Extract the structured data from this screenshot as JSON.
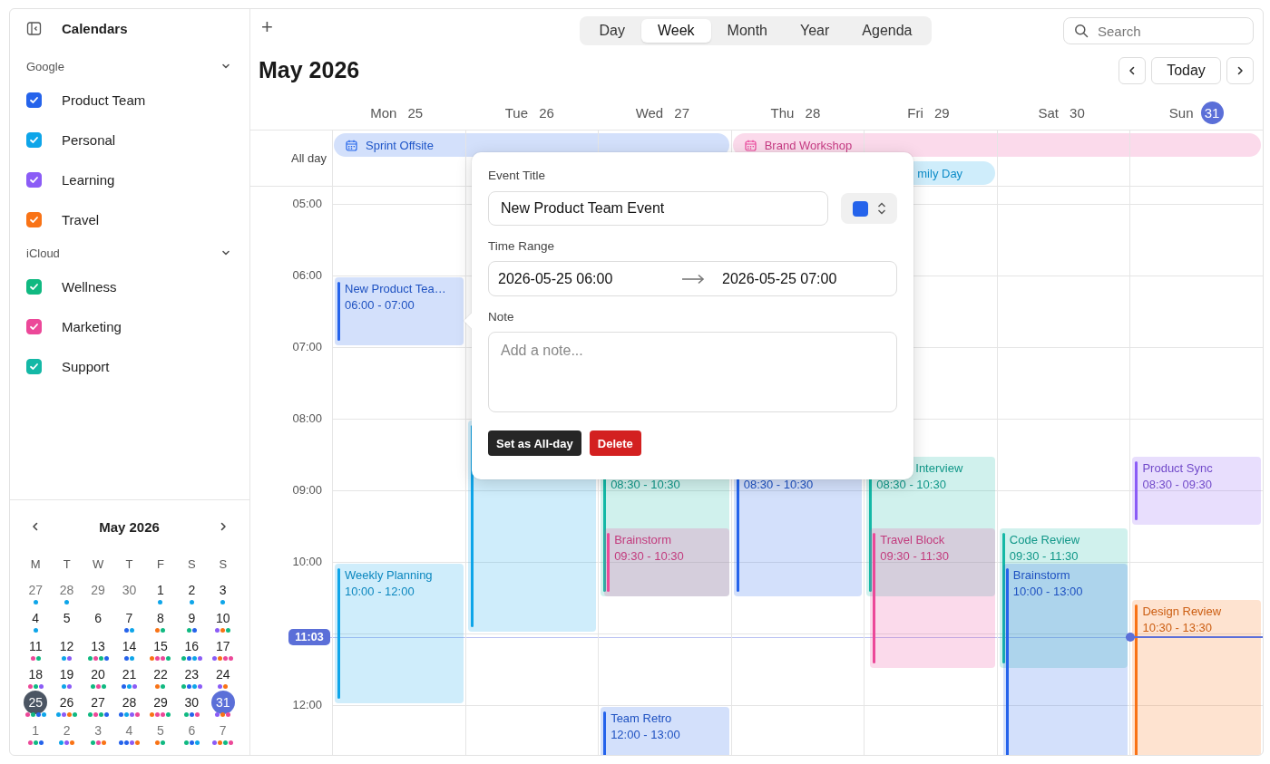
{
  "sidebar": {
    "title": "Calendars",
    "groups": [
      {
        "name": "Google",
        "expanded": true,
        "calendars": [
          {
            "name": "Product Team",
            "checked": true,
            "color": "#2563eb"
          },
          {
            "name": "Personal",
            "checked": true,
            "color": "#0ea5e9"
          },
          {
            "name": "Learning",
            "checked": true,
            "color": "#8b5cf6"
          },
          {
            "name": "Travel",
            "checked": true,
            "color": "#f97316"
          }
        ]
      },
      {
        "name": "iCloud",
        "expanded": true,
        "calendars": [
          {
            "name": "Wellness",
            "checked": true,
            "color": "#10b981"
          },
          {
            "name": "Marketing",
            "checked": true,
            "color": "#ec4899"
          },
          {
            "name": "Support",
            "checked": true,
            "color": "#14b8a6"
          }
        ]
      }
    ]
  },
  "mini_calendar": {
    "title": "May 2026",
    "weekdays": [
      "M",
      "T",
      "W",
      "T",
      "F",
      "S",
      "S"
    ],
    "weeks": [
      {
        "days": [
          {
            "date": "27",
            "outside": true,
            "selected": false,
            "today": false,
            "dots": [
              {
                "color": "#0ea5e9"
              }
            ]
          },
          {
            "date": "28",
            "outside": true,
            "selected": false,
            "today": false,
            "dots": [
              {
                "color": "#0ea5e9"
              }
            ]
          },
          {
            "date": "29",
            "outside": true,
            "selected": false,
            "today": false
          },
          {
            "date": "30",
            "outside": true,
            "selected": false,
            "today": false
          },
          {
            "date": "1",
            "outside": false,
            "selected": false,
            "today": false,
            "dots": [
              {
                "color": "#0ea5e9"
              }
            ]
          },
          {
            "date": "2",
            "outside": false,
            "selected": false,
            "today": false,
            "dots": [
              {
                "color": "#0ea5e9"
              }
            ]
          },
          {
            "date": "3",
            "outside": false,
            "selected": false,
            "today": false,
            "dots": [
              {
                "color": "#0ea5e9"
              }
            ]
          }
        ]
      },
      {
        "days": [
          {
            "date": "4",
            "outside": false,
            "selected": false,
            "today": false,
            "dots": [
              {
                "color": "#0ea5e9"
              }
            ]
          },
          {
            "date": "5",
            "outside": false,
            "selected": false,
            "today": false
          },
          {
            "date": "6",
            "outside": false,
            "selected": false,
            "today": false
          },
          {
            "date": "7",
            "outside": false,
            "selected": false,
            "today": false,
            "dots": [
              {
                "color": "#2563eb"
              },
              {
                "color": "#0ea5e9"
              }
            ]
          },
          {
            "date": "8",
            "outside": false,
            "selected": false,
            "today": false,
            "dots": [
              {
                "color": "#f97316"
              },
              {
                "color": "#10b981"
              }
            ]
          },
          {
            "date": "9",
            "outside": false,
            "selected": false,
            "today": false,
            "dots": [
              {
                "color": "#10b981"
              },
              {
                "color": "#2563eb"
              }
            ]
          },
          {
            "date": "10",
            "outside": false,
            "selected": false,
            "today": false,
            "dots": [
              {
                "color": "#8b5cf6"
              },
              {
                "color": "#f97316"
              },
              {
                "color": "#10b981"
              }
            ]
          }
        ]
      },
      {
        "days": [
          {
            "date": "11",
            "outside": false,
            "selected": false,
            "today": false,
            "dots": [
              {
                "color": "#ec4899"
              },
              {
                "color": "#10b981"
              }
            ]
          },
          {
            "date": "12",
            "outside": false,
            "selected": false,
            "today": false,
            "dots": [
              {
                "color": "#0ea5e9"
              },
              {
                "color": "#8b5cf6"
              }
            ]
          },
          {
            "date": "13",
            "outside": false,
            "selected": false,
            "today": false,
            "dots": [
              {
                "color": "#10b981"
              },
              {
                "color": "#ec4899"
              },
              {
                "color": "#10b981"
              },
              {
                "color": "#2563eb"
              }
            ]
          },
          {
            "date": "14",
            "outside": false,
            "selected": false,
            "today": false,
            "dots": [
              {
                "color": "#2563eb"
              },
              {
                "color": "#0ea5e9"
              }
            ]
          },
          {
            "date": "15",
            "outside": false,
            "selected": false,
            "today": false,
            "dots": [
              {
                "color": "#f97316"
              },
              {
                "color": "#ec4899"
              },
              {
                "color": "#ec4899"
              },
              {
                "color": "#10b981"
              }
            ]
          },
          {
            "date": "16",
            "outside": false,
            "selected": false,
            "today": false,
            "dots": [
              {
                "color": "#10b981"
              },
              {
                "color": "#2563eb"
              },
              {
                "color": "#0ea5e9"
              },
              {
                "color": "#8b5cf6"
              }
            ]
          },
          {
            "date": "17",
            "outside": false,
            "selected": false,
            "today": false,
            "dots": [
              {
                "color": "#8b5cf6"
              },
              {
                "color": "#f97316"
              },
              {
                "color": "#ec4899"
              },
              {
                "color": "#ec4899"
              }
            ]
          }
        ]
      },
      {
        "days": [
          {
            "date": "18",
            "outside": false,
            "selected": false,
            "today": false,
            "dots": [
              {
                "color": "#ec4899"
              },
              {
                "color": "#10b981"
              },
              {
                "color": "#8b5cf6"
              }
            ]
          },
          {
            "date": "19",
            "outside": false,
            "selected": false,
            "today": false,
            "dots": [
              {
                "color": "#0ea5e9"
              },
              {
                "color": "#8b5cf6"
              }
            ]
          },
          {
            "date": "20",
            "outside": false,
            "selected": false,
            "today": false,
            "dots": [
              {
                "color": "#10b981"
              },
              {
                "color": "#ec4899"
              },
              {
                "color": "#10b981"
              }
            ]
          },
          {
            "date": "21",
            "outside": false,
            "selected": false,
            "today": false,
            "dots": [
              {
                "color": "#2563eb"
              },
              {
                "color": "#0ea5e9"
              },
              {
                "color": "#8b5cf6"
              }
            ]
          },
          {
            "date": "22",
            "outside": false,
            "selected": false,
            "today": false,
            "dots": [
              {
                "color": "#f97316"
              },
              {
                "color": "#10b981"
              }
            ]
          },
          {
            "date": "23",
            "outside": false,
            "selected": false,
            "today": false,
            "dots": [
              {
                "color": "#10b981"
              },
              {
                "color": "#2563eb"
              },
              {
                "color": "#0ea5e9"
              },
              {
                "color": "#8b5cf6"
              }
            ]
          },
          {
            "date": "24",
            "outside": false,
            "selected": false,
            "today": false,
            "dots": [
              {
                "color": "#8b5cf6"
              },
              {
                "color": "#f97316"
              }
            ]
          }
        ]
      },
      {
        "days": [
          {
            "date": "25",
            "outside": false,
            "selected": true,
            "today": false,
            "dots": [
              {
                "color": "#ec4899"
              },
              {
                "color": "#10b981"
              },
              {
                "color": "#2563eb"
              },
              {
                "color": "#0ea5e9"
              }
            ]
          },
          {
            "date": "26",
            "outside": false,
            "selected": false,
            "today": false,
            "dots": [
              {
                "color": "#0ea5e9"
              },
              {
                "color": "#8b5cf6"
              },
              {
                "color": "#f97316"
              },
              {
                "color": "#10b981"
              }
            ]
          },
          {
            "date": "27",
            "outside": false,
            "selected": false,
            "today": false,
            "dots": [
              {
                "color": "#10b981"
              },
              {
                "color": "#ec4899"
              },
              {
                "color": "#10b981"
              },
              {
                "color": "#2563eb"
              }
            ]
          },
          {
            "date": "28",
            "outside": false,
            "selected": false,
            "today": false,
            "dots": [
              {
                "color": "#2563eb"
              },
              {
                "color": "#0ea5e9"
              },
              {
                "color": "#8b5cf6"
              },
              {
                "color": "#ec4899"
              }
            ]
          },
          {
            "date": "29",
            "outside": false,
            "selected": false,
            "today": false,
            "dots": [
              {
                "color": "#f97316"
              },
              {
                "color": "#ec4899"
              },
              {
                "color": "#ec4899"
              },
              {
                "color": "#10b981"
              }
            ]
          },
          {
            "date": "30",
            "outside": false,
            "selected": false,
            "today": false,
            "dots": [
              {
                "color": "#10b981"
              },
              {
                "color": "#2563eb"
              },
              {
                "color": "#ec4899"
              }
            ]
          },
          {
            "date": "31",
            "outside": false,
            "selected": false,
            "today": true,
            "dots": [
              {
                "color": "#8b5cf6"
              },
              {
                "color": "#f97316"
              },
              {
                "color": "#ec4899"
              }
            ]
          }
        ]
      },
      {
        "days": [
          {
            "date": "1",
            "outside": true,
            "selected": false,
            "today": false,
            "dots": [
              {
                "color": "#ec4899"
              },
              {
                "color": "#10b981"
              },
              {
                "color": "#2563eb"
              }
            ]
          },
          {
            "date": "2",
            "outside": true,
            "selected": false,
            "today": false,
            "dots": [
              {
                "color": "#0ea5e9"
              },
              {
                "color": "#8b5cf6"
              },
              {
                "color": "#f97316"
              }
            ]
          },
          {
            "date": "3",
            "outside": true,
            "selected": false,
            "today": false,
            "dots": [
              {
                "color": "#10b981"
              },
              {
                "color": "#ec4899"
              },
              {
                "color": "#f97316"
              }
            ]
          },
          {
            "date": "4",
            "outside": true,
            "selected": false,
            "today": false,
            "dots": [
              {
                "color": "#2563eb"
              },
              {
                "color": "#2563eb"
              },
              {
                "color": "#8b5cf6"
              },
              {
                "color": "#f97316"
              }
            ]
          },
          {
            "date": "5",
            "outside": true,
            "selected": false,
            "today": false,
            "dots": [
              {
                "color": "#f97316"
              },
              {
                "color": "#10b981"
              }
            ]
          },
          {
            "date": "6",
            "outside": true,
            "selected": false,
            "today": false,
            "dots": [
              {
                "color": "#10b981"
              },
              {
                "color": "#2563eb"
              },
              {
                "color": "#0ea5e9"
              }
            ]
          },
          {
            "date": "7",
            "outside": true,
            "selected": false,
            "today": false,
            "dots": [
              {
                "color": "#8b5cf6"
              },
              {
                "color": "#f97316"
              },
              {
                "color": "#10b981"
              },
              {
                "color": "#ec4899"
              }
            ]
          }
        ]
      }
    ]
  },
  "toolbar": {
    "add": "+",
    "views": [
      {
        "label": "Day",
        "selected": false
      },
      {
        "label": "Week",
        "selected": true
      },
      {
        "label": "Month",
        "selected": false
      },
      {
        "label": "Year",
        "selected": false
      },
      {
        "label": "Agenda",
        "selected": false
      }
    ],
    "search": {
      "placeholder": "Search"
    }
  },
  "header": {
    "title": "May 2026",
    "today": "Today"
  },
  "week": {
    "all_day_label": "All day",
    "hours": [
      "05:00",
      "06:00",
      "07:00",
      "08:00",
      "09:00",
      "10:00",
      "12:00"
    ],
    "now": "11:03",
    "days": [
      {
        "weekday": "Mon",
        "date": "25",
        "today": false,
        "all_day": [
          {
            "kind": "start",
            "title": "Sprint Offsite",
            "color": "#d3e0fb"
          }
        ],
        "events": [
          {
            "title": "New Product Tea…",
            "time": "06:00 - 07:00",
            "color": "#2563eb"
          },
          {
            "title": "Weekly Planning",
            "time": "10:00 - 12:00",
            "color": "#0ea5e9"
          }
        ]
      },
      {
        "weekday": "Tue",
        "date": "26",
        "today": false,
        "all_day": [
          {
            "kind": "middle",
            "color": "#d3e0fb"
          }
        ],
        "events": [
          {
            "kind": "covered",
            "color": "#0ea5e9"
          }
        ]
      },
      {
        "weekday": "Wed",
        "date": "27",
        "today": false,
        "all_day": [
          {
            "kind": "end",
            "color": "#d3e0fb"
          }
        ],
        "events": [
          {
            "time": "08:30 - 10:30",
            "color": "#14b8a6"
          },
          {
            "title": "Brainstorm",
            "time": "09:30 - 10:30",
            "color": "#ec4899"
          },
          {
            "title": "Team Retro",
            "time": "12:00 - 13:00",
            "color": "#2563eb"
          }
        ]
      },
      {
        "weekday": "Thu",
        "date": "28",
        "today": false,
        "all_day": [
          {
            "kind": "start",
            "title": "Brand Workshop",
            "color": "#fbdaeb"
          }
        ],
        "events": [
          {
            "time": "08:30 - 10:30",
            "color": "#2563eb"
          }
        ]
      },
      {
        "weekday": "Fri",
        "date": "29",
        "today": false,
        "all_day": [
          {
            "kind": "middle",
            "color": "#fbdaeb"
          },
          {
            "kind": "partly-covered",
            "title": "mily Day",
            "color": "#cfedfb"
          }
        ],
        "events": [
          {
            "kind": "partly-covered",
            "title": "Interview",
            "time": "08:30 - 10:30",
            "color": "#14b8a6"
          },
          {
            "title": "Travel Block",
            "time": "09:30 - 11:30",
            "color": "#ec4899"
          }
        ]
      },
      {
        "weekday": "Sat",
        "date": "30",
        "today": false,
        "all_day": [
          {
            "kind": "middle",
            "color": "#fbdaeb"
          }
        ],
        "events": [
          {
            "title": "Code Review",
            "time": "09:30 - 11:30",
            "color": "#14b8a6"
          },
          {
            "title": "Brainstorm",
            "time": "10:00 - 13:00",
            "color": "#2563eb"
          }
        ]
      },
      {
        "weekday": "Sun",
        "date": "31",
        "today": true,
        "all_day": [
          {
            "kind": "end",
            "color": "#fbdaeb"
          }
        ],
        "events": [
          {
            "title": "Product Sync",
            "time": "08:30 - 09:30",
            "color": "#8b5cf6"
          },
          {
            "title": "Design Review",
            "time": "10:30 - 13:30",
            "color": "#f97316"
          }
        ]
      }
    ]
  },
  "popover": {
    "title_label": "Event Title",
    "title_value": "New Product Team Event",
    "color": "#2563eb",
    "range_label": "Time Range",
    "start": "2026-05-25 06:00",
    "end": "2026-05-25 07:00",
    "note_label": "Note",
    "note_placeholder": "Add a note...",
    "buttons": [
      {
        "label": "Set as All-day",
        "kind": "primary"
      },
      {
        "label": "Delete",
        "kind": "danger"
      }
    ]
  }
}
